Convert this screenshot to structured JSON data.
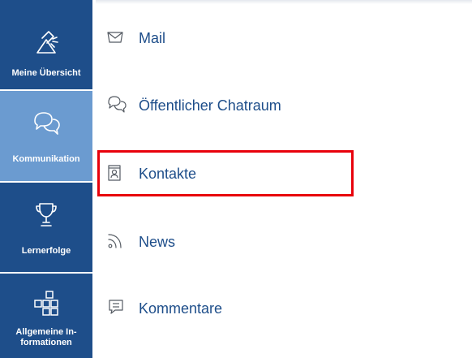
{
  "sidebar": {
    "items": [
      {
        "label_lines": [
          "Meine Übersicht"
        ],
        "icon": "lamp-icon",
        "active": false
      },
      {
        "label_lines": [
          "Kommunikation"
        ],
        "icon": "chat-bubbles-icon",
        "active": true
      },
      {
        "label_lines": [
          "Lernerfolge"
        ],
        "icon": "trophy-icon",
        "active": false
      },
      {
        "label_lines": [
          "Allgemeine In-",
          "formationen"
        ],
        "icon": "blocks-icon",
        "active": false
      }
    ]
  },
  "menu": {
    "items": [
      {
        "label": "Mail",
        "icon": "envelope-icon"
      },
      {
        "label": "Öffentlicher Chatraum",
        "icon": "chat-bubbles-icon"
      },
      {
        "label": "Kontakte",
        "icon": "contact-card-icon",
        "highlighted": true
      },
      {
        "label": "News",
        "icon": "rss-icon"
      },
      {
        "label": "Kommentare",
        "icon": "comment-icon"
      }
    ]
  },
  "colors": {
    "sidebar_bg": "#1e4e8a",
    "sidebar_active_bg": "#6b9bd0",
    "menu_text": "#1e4e8a",
    "highlight_border": "#e8000b"
  }
}
